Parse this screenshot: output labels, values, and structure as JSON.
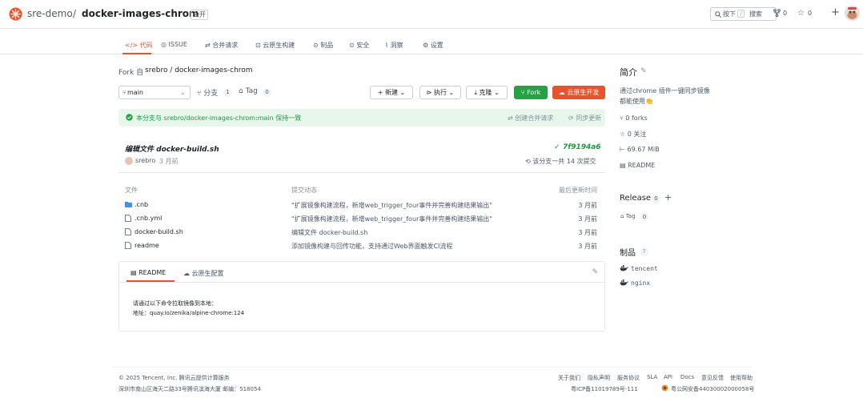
{
  "header": {
    "owner": "sre-demo",
    "separator": "/",
    "repo_name": "docker-images-chrom",
    "visibility": "公开",
    "search": {
      "shortcut": "按下",
      "key": "/",
      "label": "搜索"
    },
    "fork_count": "0",
    "star_count": "0",
    "plus": "+"
  },
  "tabs": [
    {
      "icon": "</>",
      "label": "代码"
    },
    {
      "icon": "◎",
      "label": "ISSUE"
    },
    {
      "icon": "⇄",
      "label": "合并请求"
    },
    {
      "icon": "⊡",
      "label": "云原生构建"
    },
    {
      "icon": "⊙",
      "label": "制品"
    },
    {
      "icon": "⊙",
      "label": "安全"
    },
    {
      "icon": "⌇",
      "label": "洞察"
    },
    {
      "icon": "⚙",
      "label": "设置"
    }
  ],
  "fork_info": {
    "prefix": "Fork 自",
    "source": "srebro / docker-images-chrom"
  },
  "toolbar": {
    "branch": "main",
    "branches_label": "分支",
    "branches_count": "1",
    "tags_label": "Tag",
    "tags_count": "0",
    "new_label": "新建",
    "run_label": "执行",
    "download_label": "克隆",
    "fork_label": "Fork",
    "cloud_dev_label": "云原生开发"
  },
  "sync": {
    "text": "本分支与 srebro/docker-images-chrom:main 保持一致",
    "create_pr": "创建合并请求",
    "sync_changes": "同步更新"
  },
  "commit": {
    "message": "编辑文件 docker-build.sh",
    "check": "✓",
    "sha": "7f9194a6",
    "author": "srebro",
    "time": "3 月前",
    "count": "该分支一共 14 次提交"
  },
  "file_table": {
    "headers": {
      "file": "文件",
      "message": "提交动态",
      "time": "最后更新时间"
    },
    "rows": [
      {
        "type": "folder",
        "name": ".cnb",
        "message": "\"扩展镜像构建流程，新增web_trigger_four事件并完善构建结果输出\"",
        "time": "3 月前"
      },
      {
        "type": "file",
        "name": ".cnb.yml",
        "message": "\"扩展镜像构建流程，新增web_trigger_four事件并完善构建结果输出\"",
        "time": "3 月前"
      },
      {
        "type": "file",
        "name": "docker-build.sh",
        "message": "编辑文件 docker-build.sh",
        "time": "3 月前"
      },
      {
        "type": "file",
        "name": "readme",
        "message": "添加镜像构建与回传功能，支持通过Web界面触发CI流程",
        "time": "3 月前"
      }
    ]
  },
  "readme": {
    "tab_readme": "README",
    "tab_env": "云原生配置",
    "line1": "请通过以下命令拉取镜像到本地：",
    "line2": "地址：quay.io/zenika/alpine-chrome:124"
  },
  "sidebar": {
    "about_title": "简介",
    "desc_line1": "通过chrome 插件一键同步镜像",
    "desc_line2": "都能使用👏",
    "forks": "0 forks",
    "watchers": "0 关注",
    "size": "69.67 MiB",
    "readme_link": "README",
    "release_title": "Release",
    "release_count": "0",
    "release_add": "+",
    "tag_label": "Tag",
    "tag_count": "0",
    "artifacts_title": "制品",
    "artifacts_help": "?",
    "artifacts": [
      "tencent",
      "nginx"
    ]
  },
  "footer": {
    "copyright": "© 2025 Tencent, Inc. 腾讯云提供计算服务",
    "address": "深圳市南山区海天二路33号腾讯滨海大厦 邮编：518054",
    "links": [
      "关于我们",
      "隐私声明",
      "服务协议",
      "SLA",
      "API",
      "Docs",
      "意见反馈",
      "使用帮助"
    ],
    "icp": "粤ICP备11019789号-111",
    "police": "粤公网安备44030002000058号"
  },
  "colors": {
    "accent": "#e8532d",
    "success": "#25a245",
    "text": "#1f2329",
    "muted": "#4e5969"
  }
}
